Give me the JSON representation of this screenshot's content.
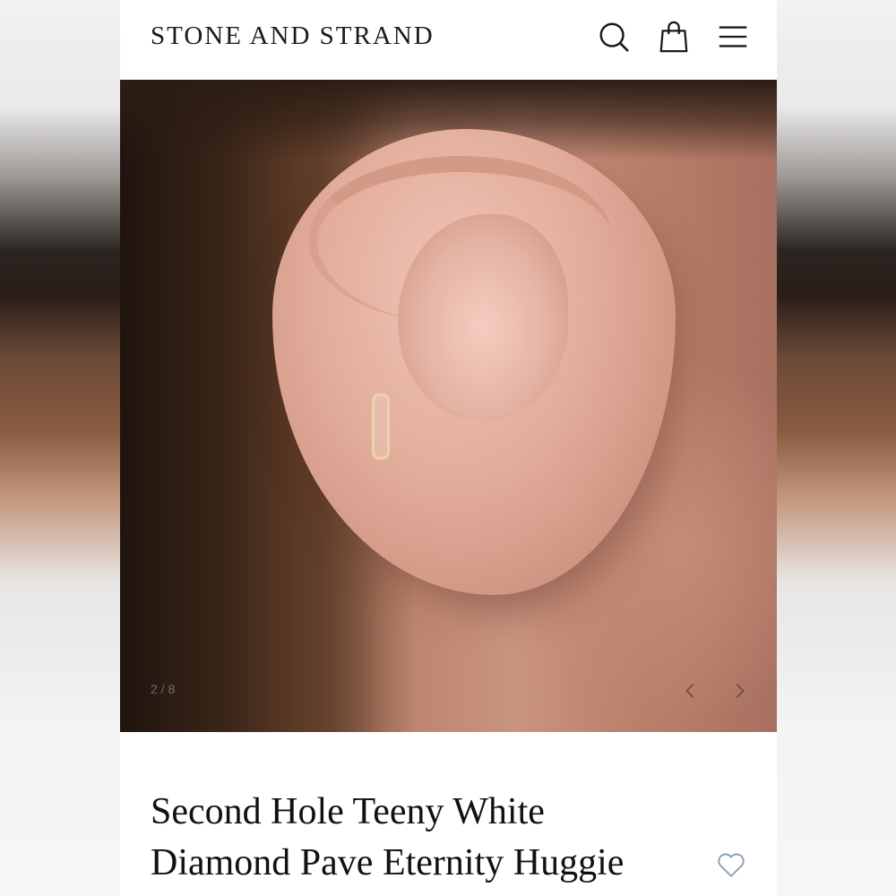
{
  "header": {
    "brand": "STONE AND STRAND",
    "icons": [
      "search-icon",
      "shopping-bag-icon",
      "menu-icon"
    ]
  },
  "gallery": {
    "image_alt": "Ear wearing a small pave diamond huggie hoop",
    "counter": "2 / 8",
    "prev_icon": "chevron-left-icon",
    "next_icon": "chevron-right-icon"
  },
  "product": {
    "title_line_1": "Second Hole Teeny White",
    "title_line_2": "Diamond Pave Eternity Huggie",
    "wishlist_icon": "heart-outline-icon"
  },
  "colors": {
    "text": "#111111",
    "icon": "#1a1a1a",
    "heart": "#8aa0b4"
  }
}
